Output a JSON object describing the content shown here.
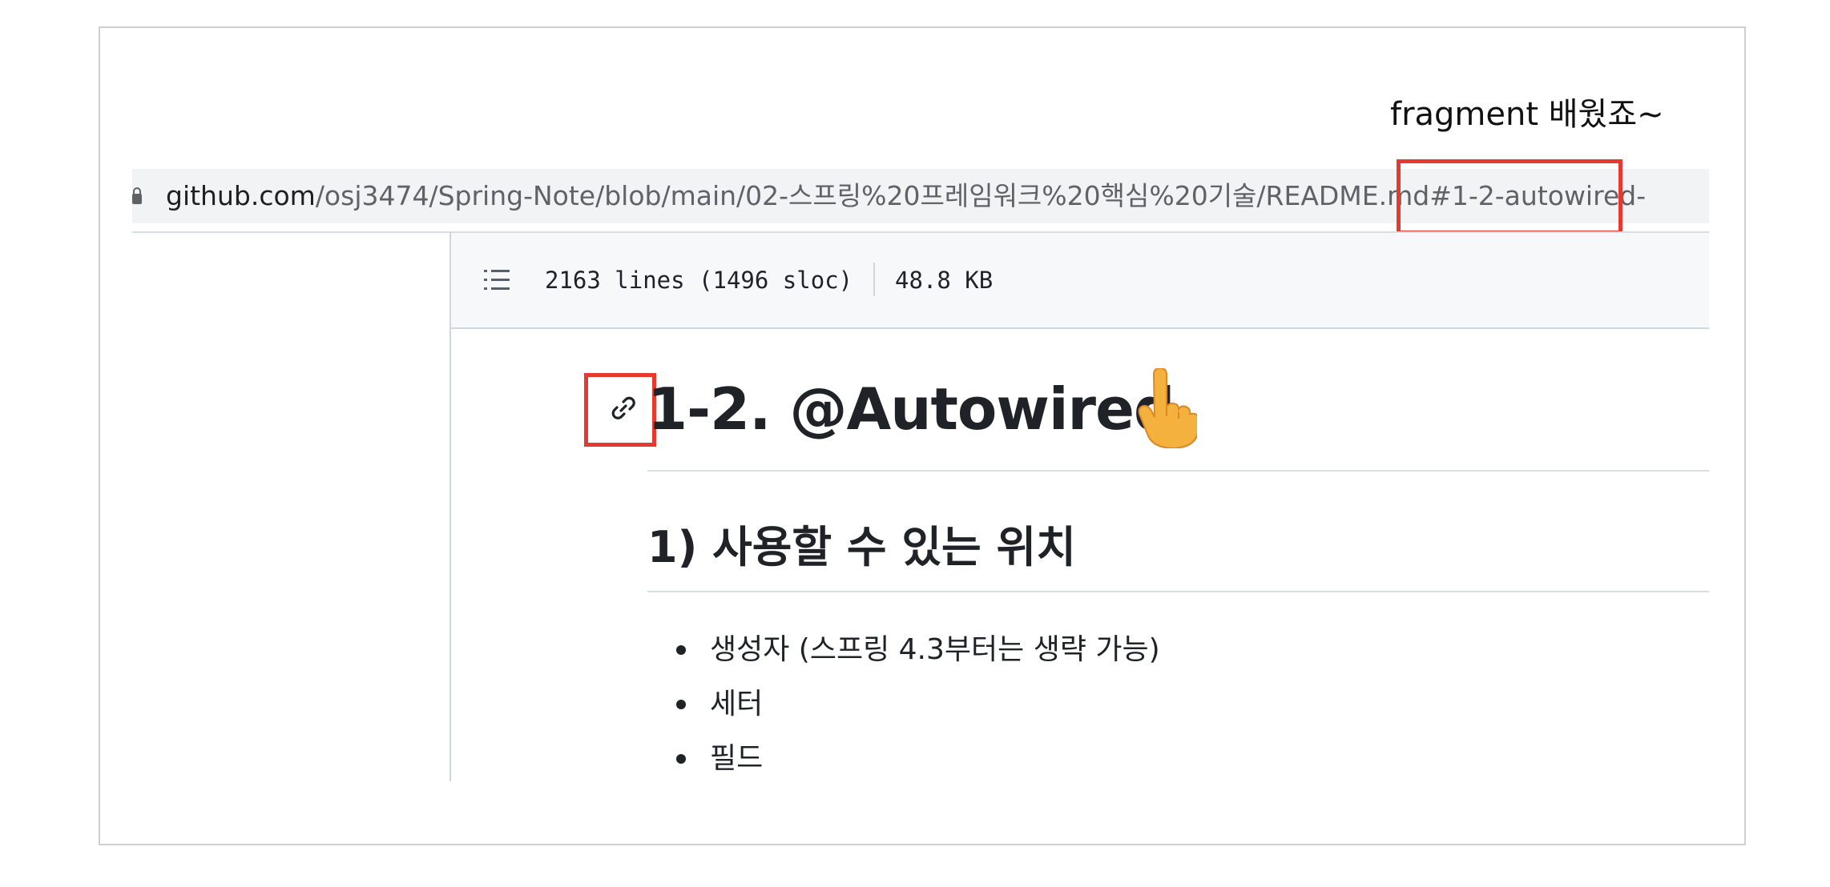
{
  "annotation": {
    "note": "fragment 배웠죠~"
  },
  "address_bar": {
    "host": "github.com",
    "path": "/osj3474/Spring-Note/blob/main/02-스프링%20프레임워크%20핵심%20기술/README.md",
    "fragment": "#1-2-autowired-"
  },
  "file_header": {
    "icon": "list-unordered-icon",
    "lines": "2163 lines (1496 sloc)",
    "size": "48.8 KB"
  },
  "content": {
    "heading1": "1-2. @Autowired",
    "heading1_icon": "link-icon",
    "heading1_emoji": "pointing-up-hand-emoji",
    "heading2": "1) 사용할 수 있는 위치",
    "bullets": [
      "생성자 (스프링 4.3부터는 생략 가능)",
      "세터",
      "필드"
    ]
  },
  "highlight_color": "#e53a2f"
}
